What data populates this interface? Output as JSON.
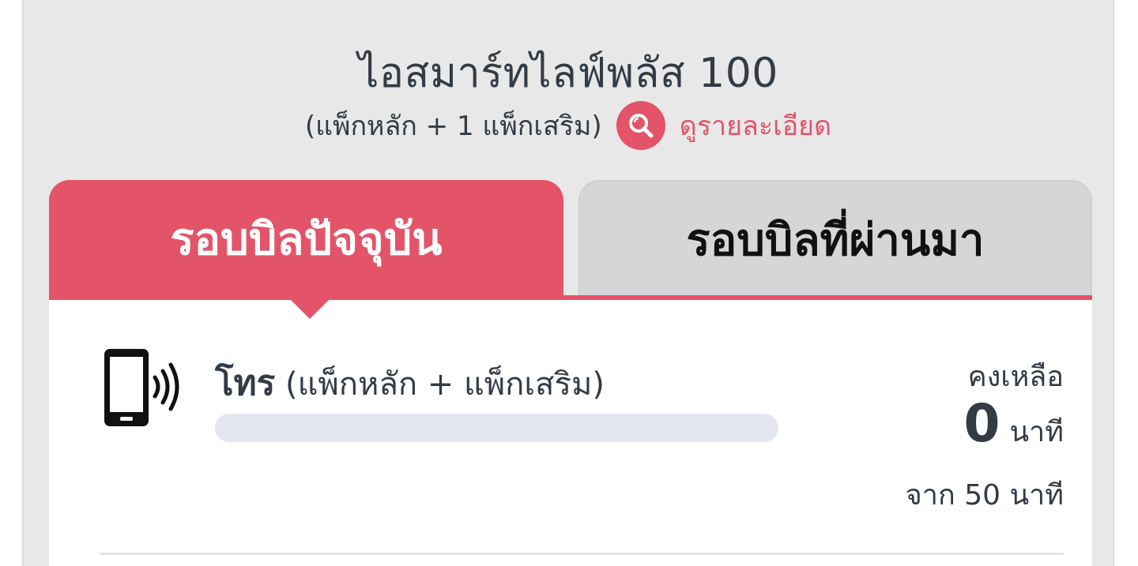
{
  "plan": {
    "name": "ไอสมาร์ทไลฟ์พลัส 100",
    "subtitle": "(แพ็กหลัก + 1 แพ็กเสริม)",
    "detail_link": "ดูรายละเอียด",
    "detail_icon": "magnifier-icon"
  },
  "tabs": [
    {
      "label": "รอบบิลปัจจุบัน",
      "active": true
    },
    {
      "label": "รอบบิลที่ผ่านมา",
      "active": false
    }
  ],
  "usage": {
    "icon": "phone-signal-icon",
    "title_main": "โทร",
    "title_detail": "(แพ็กหลัก + แพ็กเสริม)",
    "used_fraction": 0,
    "remaining_label": "คงเหลือ",
    "remaining_value": "0",
    "remaining_unit": "นาที",
    "total_text": "จาก 50 นาที"
  },
  "colors": {
    "accent": "#e35468",
    "text": "#333b45",
    "background": "#e8e8e8",
    "inactive_tab": "#d6d6d8",
    "progress_track": "#e4e7ee"
  }
}
